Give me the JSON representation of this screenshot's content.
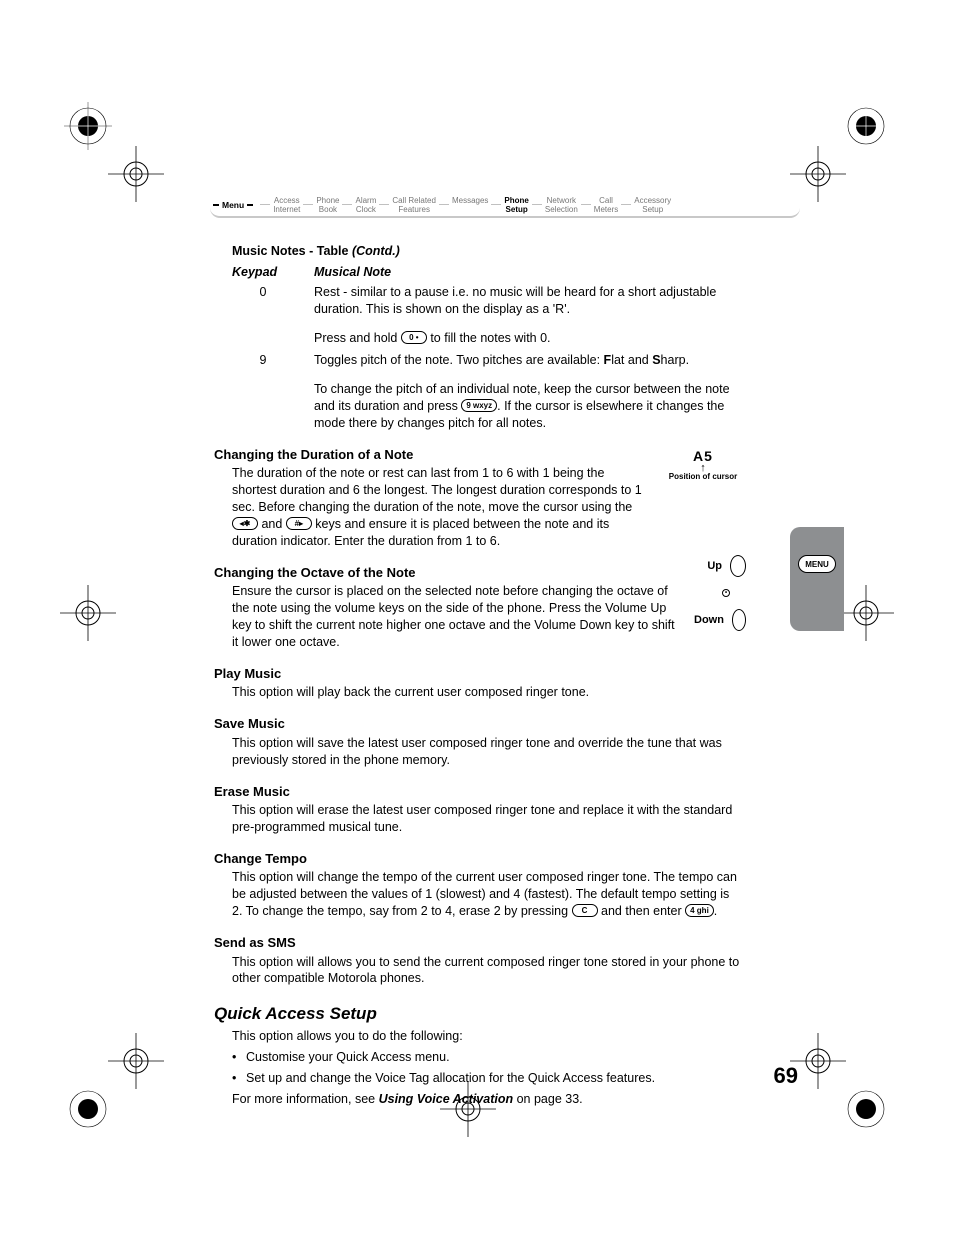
{
  "menubar": {
    "label": "Menu",
    "items": [
      "Access\nInternet",
      "Phone\nBook",
      "Alarm\nClock",
      "Call Related\nFeatures",
      "Messages",
      "Phone\nSetup",
      "Network\nSelection",
      "Call\nMeters",
      "Accessory\nSetup"
    ],
    "selected_index": 5
  },
  "table": {
    "title": "Music Notes - Table",
    "contd": "(Contd.)",
    "head_keypad": "Keypad",
    "head_note": "Musical Note",
    "rows": [
      {
        "key": "0",
        "p1": "Rest - similar to a pause i.e. no music will be heard for a short adjustable duration. This is shown on the display as a 'R'.",
        "p2a": "Press and hold ",
        "key2": "0 •",
        "p2b": " to fill the notes with 0."
      },
      {
        "key": "9",
        "p1": "Toggles pitch of the note. Two pitches are available: Flat and Sharp.",
        "p2a": "To change the pitch of an individual note, keep the cursor between the note and its duration and press ",
        "key2": "9 wxyz",
        "p2b": ". If the cursor is elsewhere it changes the mode there by changes pitch for all notes."
      }
    ]
  },
  "sections": {
    "duration": {
      "h": "Changing the Duration of a Note",
      "p_a": "The duration of the note or rest can last from 1 to 6 with 1 being the shortest duration and 6 the longest. The longest duration corresponds to 1 sec. Before changing the duration of the note, move the cursor using the ",
      "key1": "◂✱",
      "mid": " and ",
      "key2": "#▸",
      "p_b": " keys and ensure it is placed between the note and its duration indicator. Enter the duration from 1 to 6."
    },
    "octave": {
      "h": "Changing the Octave of the Note",
      "p": "Ensure the cursor is placed on the selected note before changing the octave of the note using the volume keys on the side of the phone. Press the Volume Up key to shift the current note higher one octave and the Volume Down key to shift it lower one octave."
    },
    "play": {
      "h": "Play Music",
      "p": "This option will play back the current user composed ringer tone."
    },
    "save": {
      "h": "Save Music",
      "p": "This option will save the latest user composed ringer tone and override the tune that was previously stored in the phone memory."
    },
    "erase": {
      "h": "Erase Music",
      "p": "This option will erase the latest user composed ringer tone and replace it with the standard pre-programmed musical tune."
    },
    "tempo": {
      "h": "Change Tempo",
      "p_a": "This option will change the tempo of the current user composed ringer tone. The tempo can be adjusted between the values of 1 (slowest) and 4 (fastest). The default tempo setting is 2. To change the tempo, say from 2 to 4, erase 2 by pressing ",
      "key1": "C",
      "mid": " and then enter ",
      "key2": "4 ghi",
      "p_b": "."
    },
    "sms": {
      "h": "Send as SMS",
      "p": "This option will allows you to send the current composed ringer tone stored in your phone to other compatible Motorola phones."
    }
  },
  "qas": {
    "h": "Quick Access Setup",
    "intro": "This option allows you to do the following:",
    "bullets": [
      "Customise your Quick Access menu.",
      "Set up and change the Voice Tag allocation for the Quick Access features."
    ],
    "more_a": "For more information, see ",
    "more_ref": "Using Voice Activation",
    "more_b": " on page 33."
  },
  "annotations": {
    "cursor_note": "A5",
    "cursor_label": "Position of cursor",
    "up": "Up",
    "down": "Down",
    "menu_pill": "MENU"
  },
  "page_number": "69"
}
